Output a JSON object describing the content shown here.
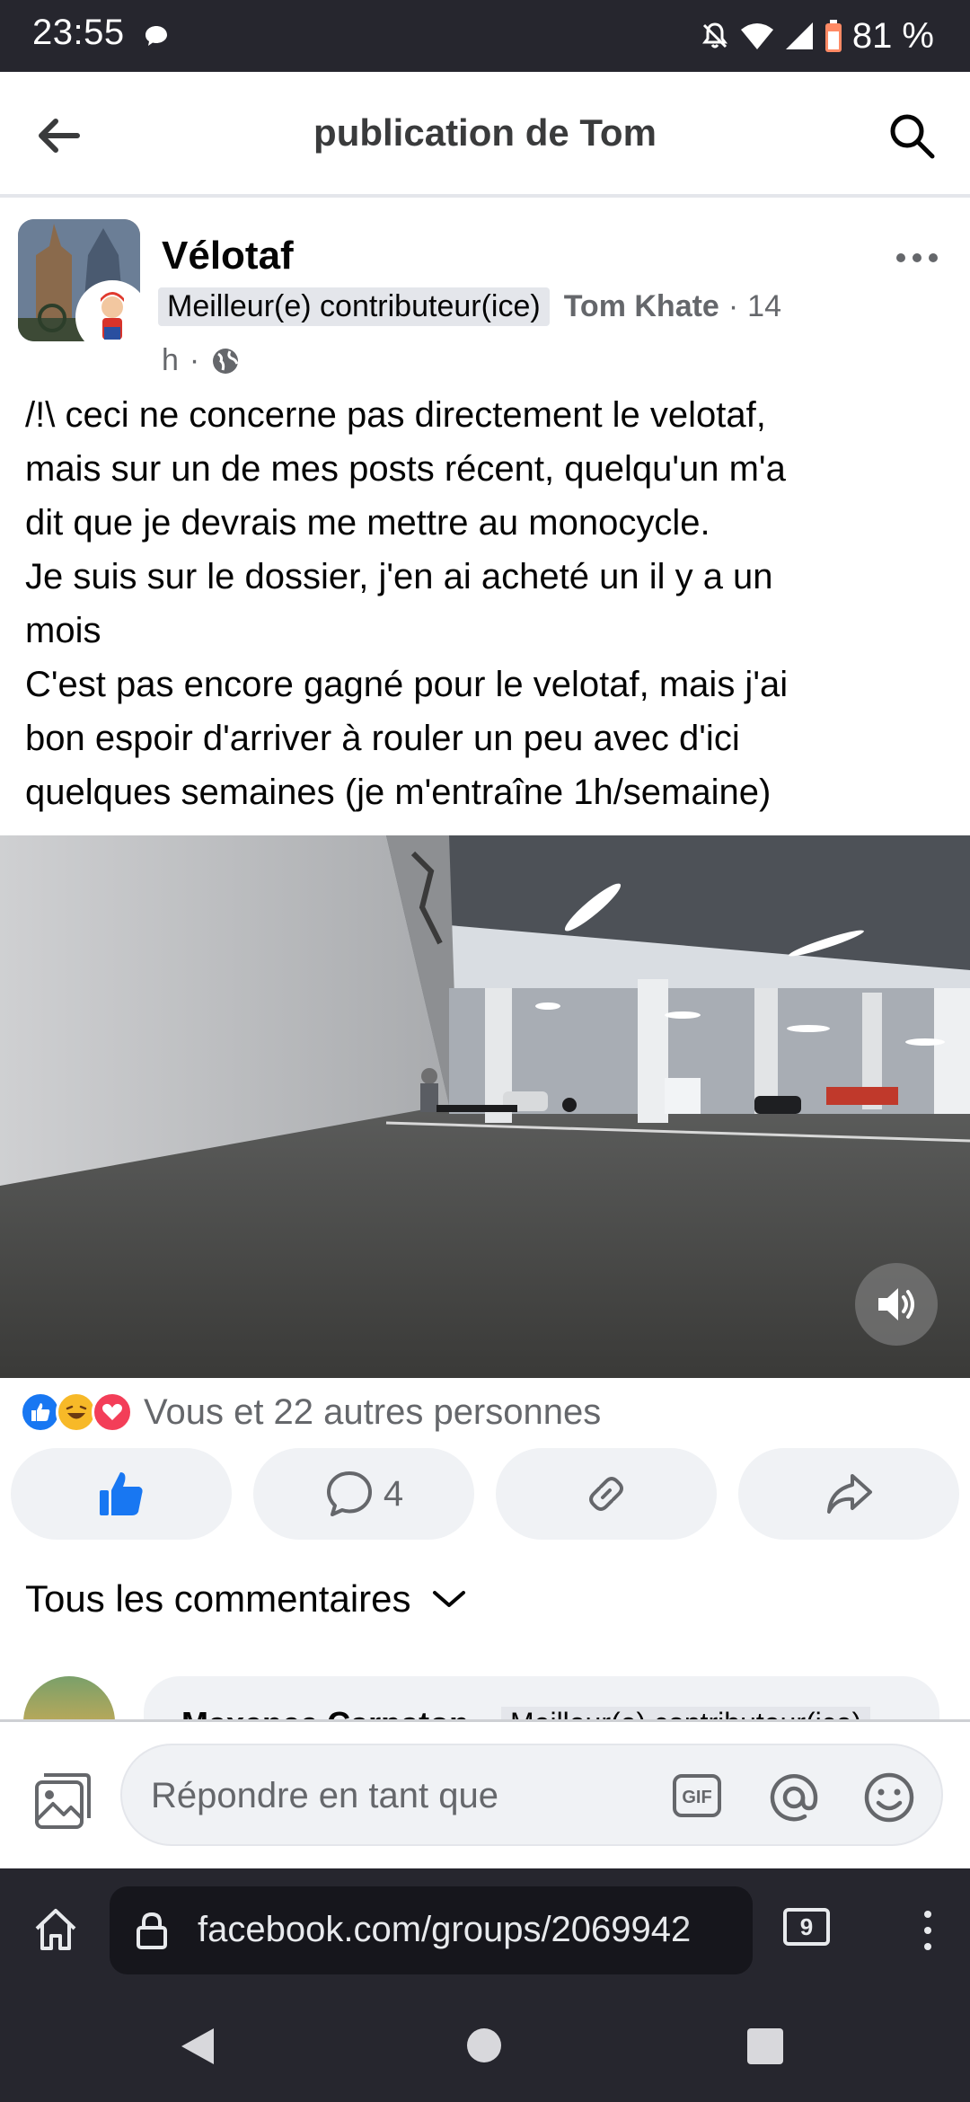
{
  "status_bar": {
    "time": "23:55",
    "battery": "81 %",
    "icons": [
      "chat-bubble-icon",
      "notifications-off-icon",
      "wifi-icon",
      "signal-icon",
      "battery-icon"
    ]
  },
  "header": {
    "title": "publication de Tom",
    "icons": [
      "back-arrow-icon",
      "search-icon"
    ]
  },
  "post": {
    "group_name": "Vélotaf",
    "badge": "Meilleur(e) contributeur(ice)",
    "author": "Tom Khate",
    "separator": "·",
    "time_part1": "14",
    "time_part2": "h",
    "visibility_icon": "globe-icon",
    "body_lines": [
      "/!\\ ceci ne concerne pas directement le velotaf,",
      "mais sur un de mes posts récent, quelqu'un m'a",
      "dit que je devrais me mettre au monocycle.",
      "Je suis sur le dossier, j'en ai acheté un il y a un",
      "mois",
      "C'est pas encore gagné pour le velotaf, mais j'ai",
      "bon espoir d'arriver à rouler un peu avec d'ici",
      "quelques semaines (je m'entraîne 1h/semaine)"
    ]
  },
  "reactions": {
    "icons": [
      "like-reaction-icon",
      "haha-reaction-icon",
      "love-reaction-icon"
    ],
    "summary": "Vous et 22 autres personnes"
  },
  "actions": {
    "like_icon": "thumbs-up-icon",
    "comment_count": "4",
    "comment_icon": "comment-icon",
    "link_icon": "link-icon",
    "share_icon": "share-icon"
  },
  "comments": {
    "header": "Tous les commentaires",
    "first_author": "Maxence Carpaton",
    "first_badge": "Meilleur(e) contributeur(ice)"
  },
  "reply_bar": {
    "placeholder": "Répondre en tant que"
  },
  "browser": {
    "url": "facebook.com/groups/2069942",
    "tab_count": "9"
  },
  "colors": {
    "facebook_blue": "#1877f2",
    "system_bar": "#26262e",
    "secondary_text": "#65676b",
    "button_bg": "#f0f2f5"
  }
}
